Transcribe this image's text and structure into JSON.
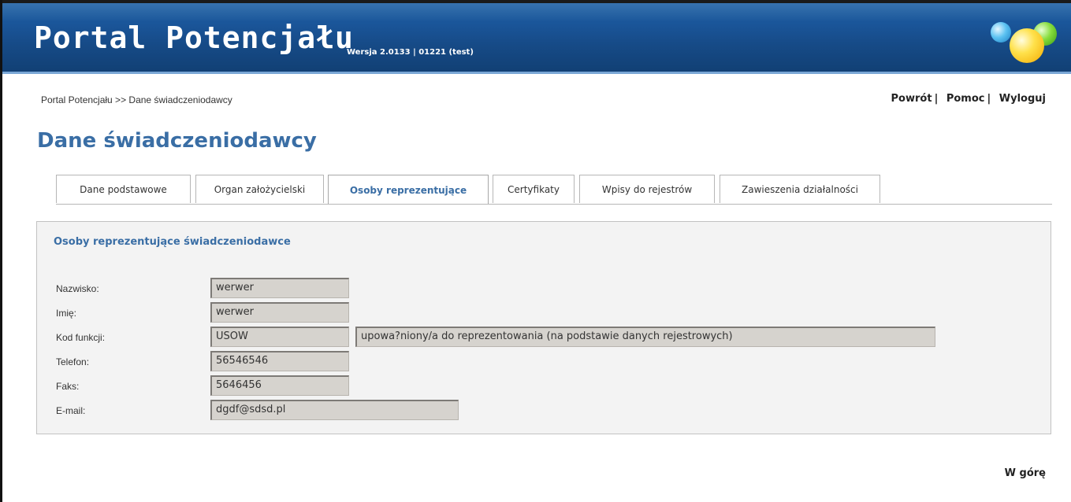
{
  "header": {
    "title": "Portal Potencjału",
    "version": "Wersja 2.0133 | 01221 (test)",
    "logo": "colored-balls-logo"
  },
  "breadcrumb": "Portal Potencjału >> Dane świadczeniodawcy",
  "top_links": {
    "back": "Powrót",
    "help": "Pomoc",
    "logout": "Wyloguj",
    "separator": "|"
  },
  "page_title": "Dane świadczeniodawcy",
  "tabs": [
    {
      "label": "Dane podstawowe",
      "active": false
    },
    {
      "label": "Organ założycielski",
      "active": false
    },
    {
      "label": "Osoby reprezentujące",
      "active": true
    },
    {
      "label": "Certyfikaty",
      "active": false
    },
    {
      "label": "Wpisy do rejestrów",
      "active": false
    },
    {
      "label": "Zawieszenia działalności",
      "active": false
    }
  ],
  "panel": {
    "title": "Osoby reprezentujące świadczeniodawce",
    "fields": {
      "nazwisko": {
        "label": "Nazwisko:",
        "value": "werwer"
      },
      "imie": {
        "label": "Imię:",
        "value": "werwer"
      },
      "kod_funkcji": {
        "label": "Kod funkcji:",
        "value": "USOW",
        "description": "upowa?niony/a do reprezentowania (na podstawie danych rejestrowych)"
      },
      "telefon": {
        "label": "Telefon:",
        "value": "56546546"
      },
      "faks": {
        "label": "Faks:",
        "value": "5646456"
      },
      "email": {
        "label": "E-mail:",
        "value": "dgdf@sdsd.pl"
      }
    }
  },
  "footer": {
    "to_top": "W górę"
  },
  "colors": {
    "header_blue": "#1a5599",
    "title_blue": "#3a6ea5",
    "field_bg": "#d6d3ce",
    "panel_bg": "#f3f3f3"
  }
}
